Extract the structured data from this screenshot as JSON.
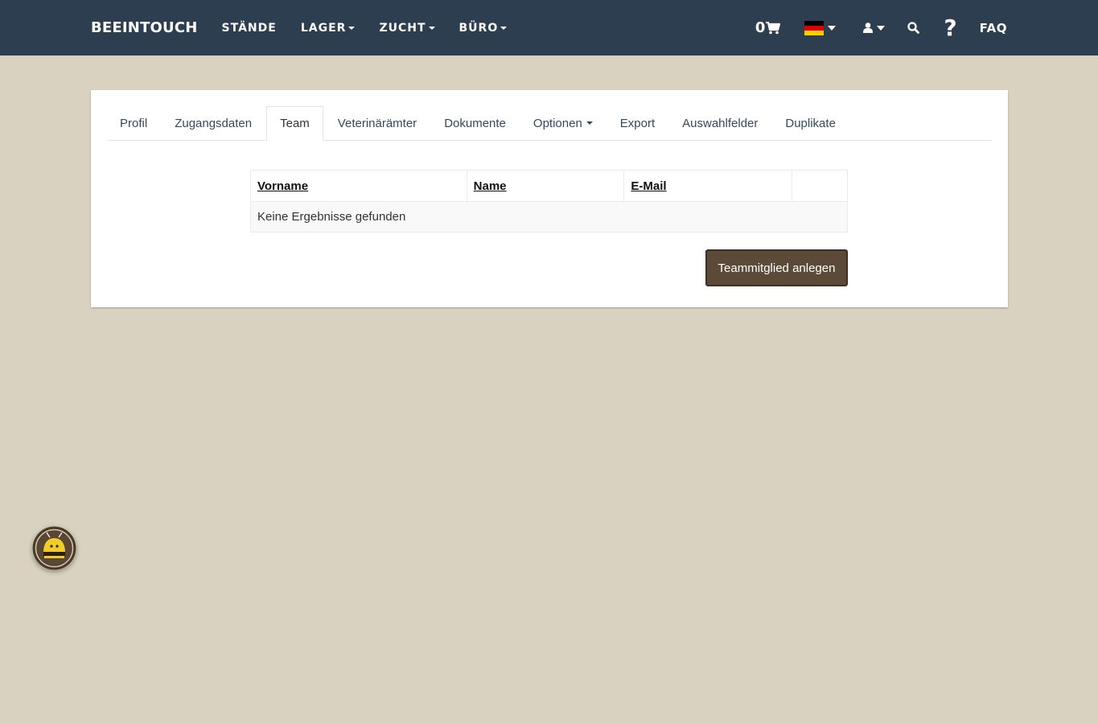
{
  "navbar": {
    "brand": "BEEINTOUCH",
    "links": [
      {
        "label": "STÄNDE",
        "dropdown": false
      },
      {
        "label": "LAGER",
        "dropdown": true
      },
      {
        "label": "ZUCHT",
        "dropdown": true
      },
      {
        "label": "BÜRO",
        "dropdown": true
      }
    ],
    "cart_count": "0",
    "cart_icon": "shopping-cart-icon",
    "language_flag": "germany-flag-icon",
    "user_icon": "user-icon",
    "search_icon": "search-icon",
    "help_icon": "?",
    "faq_label": "FAQ",
    "bg_color": "#2c3e50"
  },
  "tabs": [
    {
      "label": "Profil",
      "active": false
    },
    {
      "label": "Zugangsdaten",
      "active": false
    },
    {
      "label": "Team",
      "active": true
    },
    {
      "label": "Veterinärämter",
      "active": false
    },
    {
      "label": "Dokumente",
      "active": false
    },
    {
      "label": "Optionen",
      "active": false,
      "dropdown": true
    },
    {
      "label": "Export",
      "active": false
    },
    {
      "label": "Auswahlfelder",
      "active": false
    },
    {
      "label": "Duplikate",
      "active": false
    }
  ],
  "table": {
    "columns": [
      "Vorname",
      "Name",
      "E-Mail",
      ""
    ],
    "empty_message": "Keine Ergebnisse gefunden"
  },
  "create_button_label": "Teammitglied anlegen",
  "colors": {
    "page_bg": "#d9d2c0",
    "button_bg": "#5c4a39"
  },
  "widget_icon": "bee-mascot-icon"
}
